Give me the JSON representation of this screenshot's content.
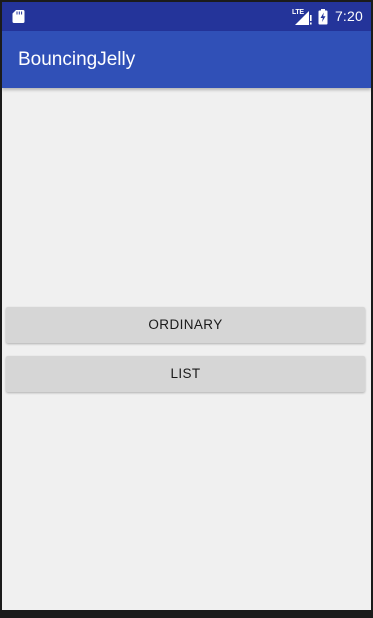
{
  "status_bar": {
    "left_icon": "sd-card-icon",
    "network_label": "LTE",
    "signal_icon": "signal-icon",
    "battery_icon": "battery-charging-icon",
    "time": "7:20"
  },
  "app_bar": {
    "title": "BouncingJelly"
  },
  "buttons": {
    "ordinary_label": "ORDINARY",
    "list_label": "LIST"
  },
  "colors": {
    "status_bar": "#24349a",
    "app_bar": "#3050b7",
    "background": "#f0f0f0",
    "button": "#d6d6d6"
  }
}
